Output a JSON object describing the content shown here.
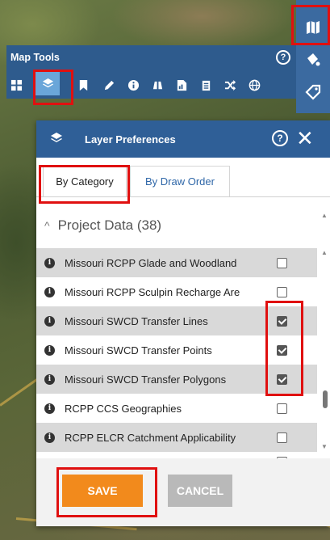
{
  "right_toolbar": {
    "items": [
      {
        "name": "map-icon"
      },
      {
        "name": "paint-bucket-icon"
      },
      {
        "name": "tag-icon"
      }
    ]
  },
  "map_tools": {
    "title": "Map Tools",
    "help_label": "?",
    "tools": [
      {
        "name": "grid-icon"
      },
      {
        "name": "layers-icon",
        "active": true
      },
      {
        "name": "bookmark-icon"
      },
      {
        "name": "pencil-icon"
      },
      {
        "name": "info-icon"
      },
      {
        "name": "binoculars-icon"
      },
      {
        "name": "report-icon"
      },
      {
        "name": "clipboard-icon"
      },
      {
        "name": "shuffle-icon"
      },
      {
        "name": "globe-icon"
      }
    ]
  },
  "layer_preferences": {
    "title": "Layer Preferences",
    "help_label": "?",
    "close_label": "✕",
    "tabs": [
      {
        "label": "By Category",
        "active": true
      },
      {
        "label": "By Draw Order",
        "active": false
      }
    ],
    "category": {
      "label": "Project Data (38)",
      "chevron": "^"
    },
    "layers": [
      {
        "label": "Missouri RCPP Glade and Woodland",
        "checked": false,
        "shaded": true
      },
      {
        "label": "Missouri RCPP Sculpin Recharge Are",
        "checked": false,
        "shaded": false
      },
      {
        "label": "Missouri SWCD Transfer Lines",
        "checked": true,
        "shaded": true
      },
      {
        "label": "Missouri SWCD Transfer Points",
        "checked": true,
        "shaded": false
      },
      {
        "label": "Missouri SWCD Transfer Polygons",
        "checked": true,
        "shaded": true
      },
      {
        "label": "RCPP CCS Geographies",
        "checked": false,
        "shaded": false
      },
      {
        "label": "RCPP ELCR Catchment Applicability",
        "checked": false,
        "shaded": true
      }
    ],
    "save_label": "SAVE",
    "cancel_label": "CANCEL",
    "colors": {
      "header": "#2f5f97",
      "save": "#f28a1c",
      "cancel": "#b9b9b9",
      "highlight": "#e01010"
    }
  }
}
